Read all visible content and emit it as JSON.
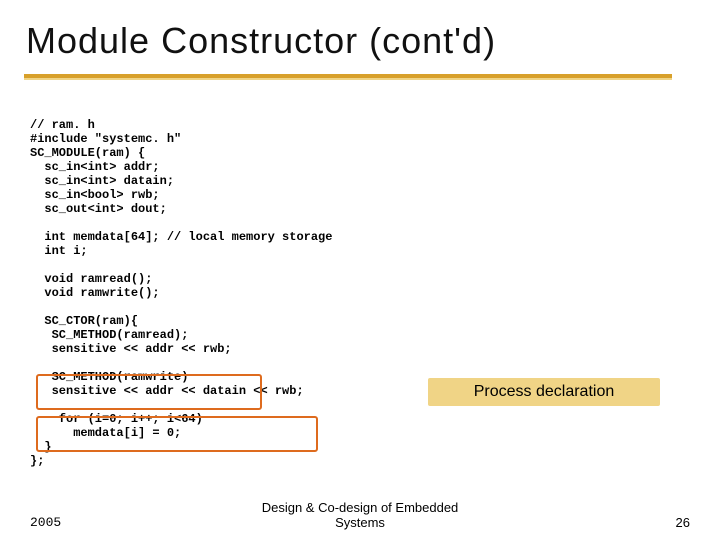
{
  "title": "Module Constructor (cont'd)",
  "code": "// ram. h\n#include \"systemc. h\"\nSC_MODULE(ram) {\n  sc_in<int> addr;\n  sc_in<int> datain;\n  sc_in<bool> rwb;\n  sc_out<int> dout;\n\n  int memdata[64]; // local memory storage\n  int i;\n\n  void ramread();\n  void ramwrite();\n\n  SC_CTOR(ram){\n   SC_METHOD(ramread);\n   sensitive << addr << rwb;\n\n   SC_METHOD(ramwrite)\n   sensitive << addr << datain << rwb;\n\n    for (i=0; i++; i<64)\n      memdata[i] = 0;\n  }\n};",
  "callout": "Process declaration",
  "footer": {
    "center_line1": "Design & Co-design of Embedded",
    "center_line2": "Systems",
    "left": "2005",
    "right": "26"
  }
}
